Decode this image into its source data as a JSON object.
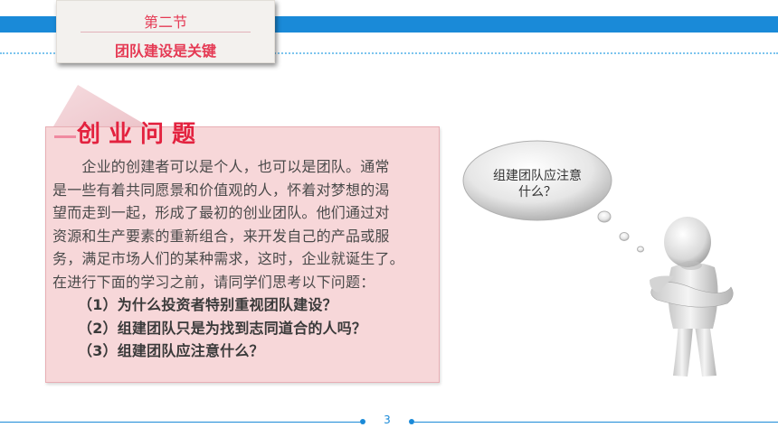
{
  "header": {
    "section": "第二节",
    "title": "团队建设是关键"
  },
  "box": {
    "title": "创业问题",
    "lines": [
      "　　企业的创建者可以是个人，也可以是团队。通常",
      "是一些有着共同愿景和价值观的人，怀着对梦想的渴",
      "望而走到一起，形成了最初的创业团队。他们通过对",
      "资源和生产要素的重新组合，来开发自己的产品或服",
      "务，满足市场人们的某种需求，这时，企业就诞生了。",
      "在进行下面的学习之前，请同学们思考以下问题："
    ],
    "questions": [
      "（1）为什么投资者特别重视团队建设？",
      "（2）组建团队只是为找到志同道合的人吗？",
      "（3）组建团队应注意什么？"
    ]
  },
  "bubble": {
    "line1": "组建团队应注意",
    "line2": "什么？"
  },
  "footer": {
    "page": "3"
  },
  "colors": {
    "accent_blue": "#1a8ad8",
    "title_red": "#e3223f",
    "box_pink": "#f7d7d9"
  }
}
